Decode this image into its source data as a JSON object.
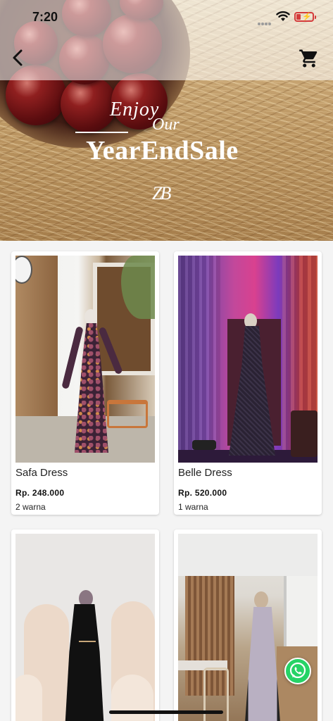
{
  "status_bar": {
    "time": "7:20"
  },
  "banner": {
    "line1": "Enjoy",
    "line2": "Our",
    "headline": "YearEndSale",
    "logo": "ZB"
  },
  "products": [
    {
      "name": "Safa Dress",
      "price": "Rp. 248.000",
      "variants": "2 warna"
    },
    {
      "name": "Belle Dress",
      "price": "Rp. 520.000",
      "variants": "1 warna"
    },
    {
      "name": "",
      "price": "",
      "variants": ""
    },
    {
      "name": "",
      "price": "",
      "variants": ""
    }
  ],
  "icons": {
    "back": "chevron-left-icon",
    "cart": "shopping-cart-icon",
    "chat": "whatsapp-icon"
  },
  "colors": {
    "accent_whatsapp": "#25d366",
    "battery_low": "#d43b3b"
  }
}
